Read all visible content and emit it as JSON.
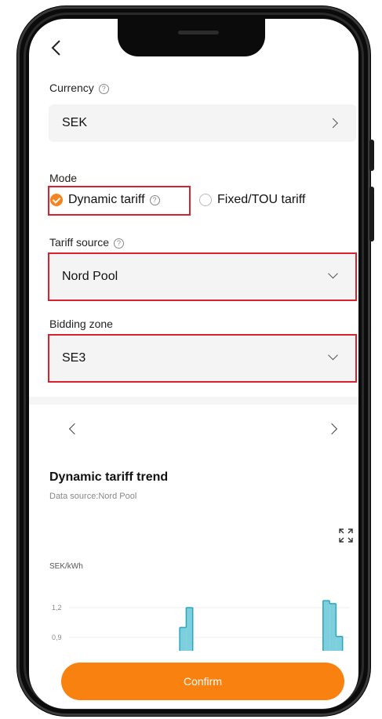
{
  "header": {
    "back_icon": "chevron-left-icon"
  },
  "currency": {
    "label": "Currency",
    "value": "SEK"
  },
  "mode": {
    "label": "Mode",
    "options": [
      {
        "label": "Dynamic tariff",
        "selected": true
      },
      {
        "label": "Fixed/TOU tariff",
        "selected": false
      }
    ]
  },
  "tariff_source": {
    "label": "Tariff source",
    "value": "Nord Pool"
  },
  "bidding_zone": {
    "label": "Bidding zone",
    "value": "SE3"
  },
  "chart": {
    "title": "Dynamic tariff trend",
    "subtitle": "Data source:Nord Pool",
    "unit": "SEK/kWh",
    "ticks": [
      "1,2",
      "0,9"
    ]
  },
  "chart_data": {
    "type": "area",
    "title": "Dynamic tariff trend",
    "ylabel": "SEK/kWh",
    "y_ticks": [
      0.9,
      1.2
    ],
    "ylim": [
      0.9,
      1.35
    ],
    "series": [
      {
        "values": [
          null,
          null,
          null,
          null,
          null,
          null,
          null,
          null,
          null,
          null,
          null,
          null,
          null,
          null,
          null,
          null,
          null,
          1.0,
          1.2,
          null,
          null,
          null,
          null,
          null,
          null,
          null,
          null,
          null,
          null,
          null,
          null,
          null,
          null,
          null,
          null,
          null,
          null,
          null,
          null,
          1.27,
          1.24,
          0.91,
          null
        ]
      }
    ],
    "colors": {
      "fill": "#7ecfdd",
      "stroke": "#2aa7bd"
    }
  },
  "footer": {
    "confirm_label": "Confirm"
  },
  "colors": {
    "accent": "#f8810f",
    "highlight": "#d8232e"
  }
}
